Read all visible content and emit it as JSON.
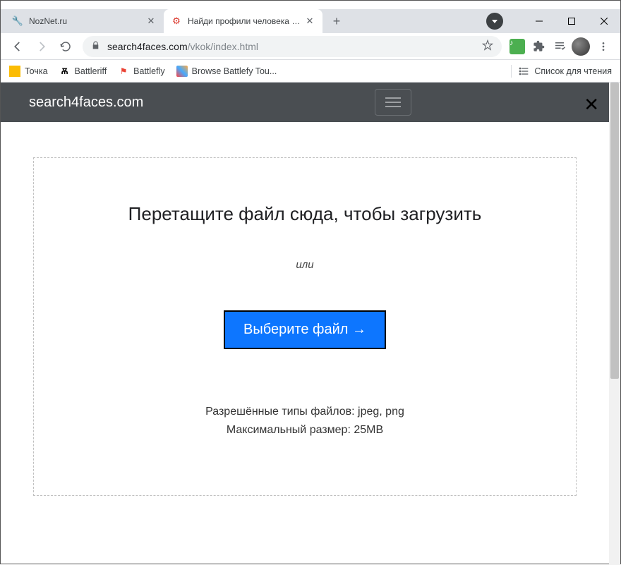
{
  "tabs": [
    {
      "title": "NozNet.ru",
      "favicon": "🔧"
    },
    {
      "title": "Найди профили человека в соц",
      "favicon": "⚙"
    }
  ],
  "toolbar": {
    "url_domain": "search4faces.com",
    "url_path": "/vkok/index.html"
  },
  "bookmarks": [
    {
      "label": "Точка"
    },
    {
      "label": "Battleriff"
    },
    {
      "label": "Battlefly"
    },
    {
      "label": "Browse Battlefy Tou..."
    }
  ],
  "reading_list_label": "Список для чтения",
  "site": {
    "brand": "search4faces.com"
  },
  "upload": {
    "heading": "Перетащите файл сюда, чтобы загрузить",
    "or": "или",
    "button": "Выберите файл →",
    "allowed": "Разрешённые типы файлов: jpeg, png",
    "maxsize": "Максимальный размер: 25MB"
  }
}
